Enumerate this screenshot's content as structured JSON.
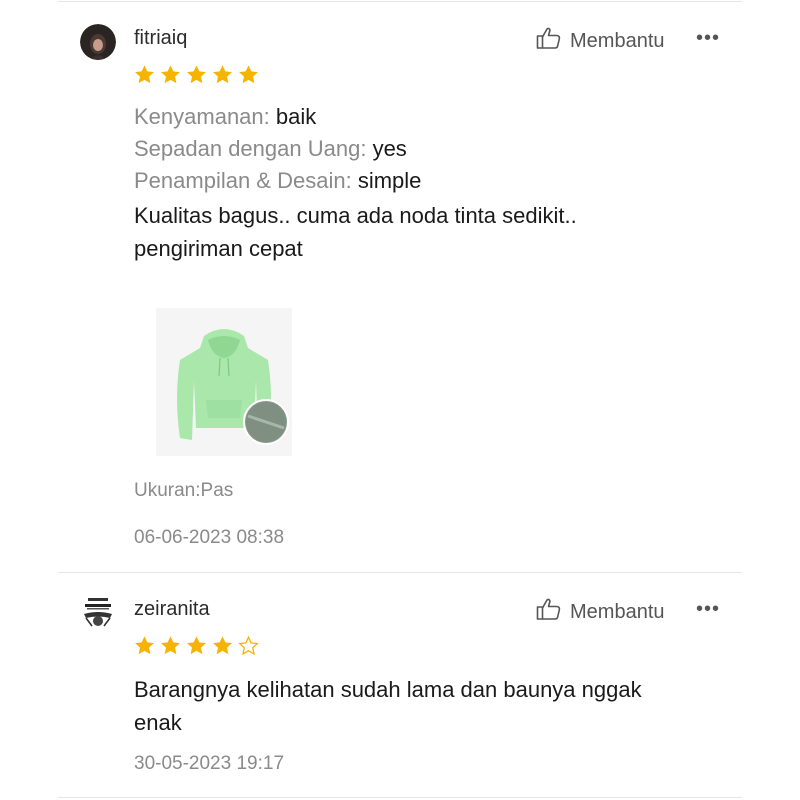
{
  "reviews": [
    {
      "username": "fitriaiq",
      "helpful_label": "Membantu",
      "more_label": "•••",
      "rating": 5,
      "max_rating": 5,
      "attributes": [
        {
          "key": "Kenyamanan:",
          "value": "baik"
        },
        {
          "key": "Sepadan dengan Uang:",
          "value": "yes"
        },
        {
          "key": "Penampilan & Desain:",
          "value": "simple"
        }
      ],
      "comment_lines": [
        "Kualitas bagus.. cuma ada noda tinta sedikit..",
        "pengiriman cepat"
      ],
      "has_photo": true,
      "size_label": "Ukuran:Pas",
      "date": "06-06-2023 08:38"
    },
    {
      "username": "zeiranita",
      "helpful_label": "Membantu",
      "more_label": "•••",
      "rating": 4,
      "max_rating": 5,
      "comment_lines": [
        "Barangnya kelihatan sudah lama dan baunya nggak",
        "enak"
      ],
      "date": "30-05-2023 19:17"
    }
  ],
  "colors": {
    "star": "#f5b400",
    "star_empty_stroke": "#f5b400",
    "muted_text": "#8a8a8a",
    "photo_hoodie": "#a8e6a8"
  }
}
